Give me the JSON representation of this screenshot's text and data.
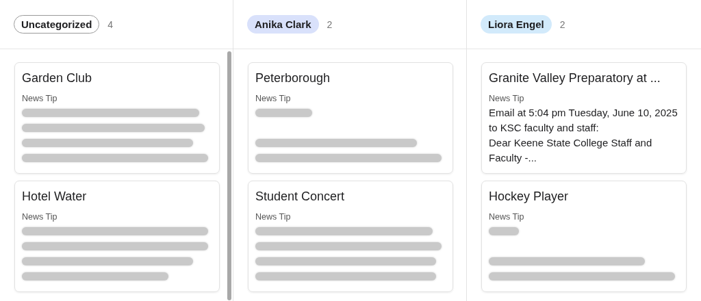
{
  "columns": [
    {
      "tag": {
        "label": "Uncategorized",
        "color": "#ffffff",
        "outlined": true
      },
      "count": "4",
      "scrollbar": true,
      "cards": [
        {
          "title": "Garden Club",
          "type": "News Tip",
          "snippet": {
            "kind": "blurred"
          }
        },
        {
          "title": "Hotel Water",
          "type": "News Tip",
          "snippet": {
            "kind": "blurred"
          }
        }
      ]
    },
    {
      "tag": {
        "label": "Anika Clark",
        "color": "#d9e1fb",
        "outlined": false
      },
      "count": "2",
      "cards": [
        {
          "title": "Peterborough",
          "type": "News Tip",
          "snippet": {
            "kind": "blurred"
          }
        },
        {
          "title": "Student Concert",
          "type": "News Tip",
          "snippet": {
            "kind": "blurred"
          }
        }
      ]
    },
    {
      "tag": {
        "label": "Liora Engel",
        "color": "#d2eafb",
        "outlined": false
      },
      "count": "2",
      "cards": [
        {
          "title": "Granite Valley Preparatory at ...",
          "type": "News Tip",
          "snippet": {
            "kind": "text",
            "text": "Email at 5:04 pm Tuesday, June 10, 2025 to KSC faculty and staff:\nDear Keene State College Staff and Faculty -..."
          }
        },
        {
          "title": "Hockey Player",
          "type": "News Tip",
          "snippet": {
            "kind": "blurred"
          }
        }
      ]
    }
  ]
}
